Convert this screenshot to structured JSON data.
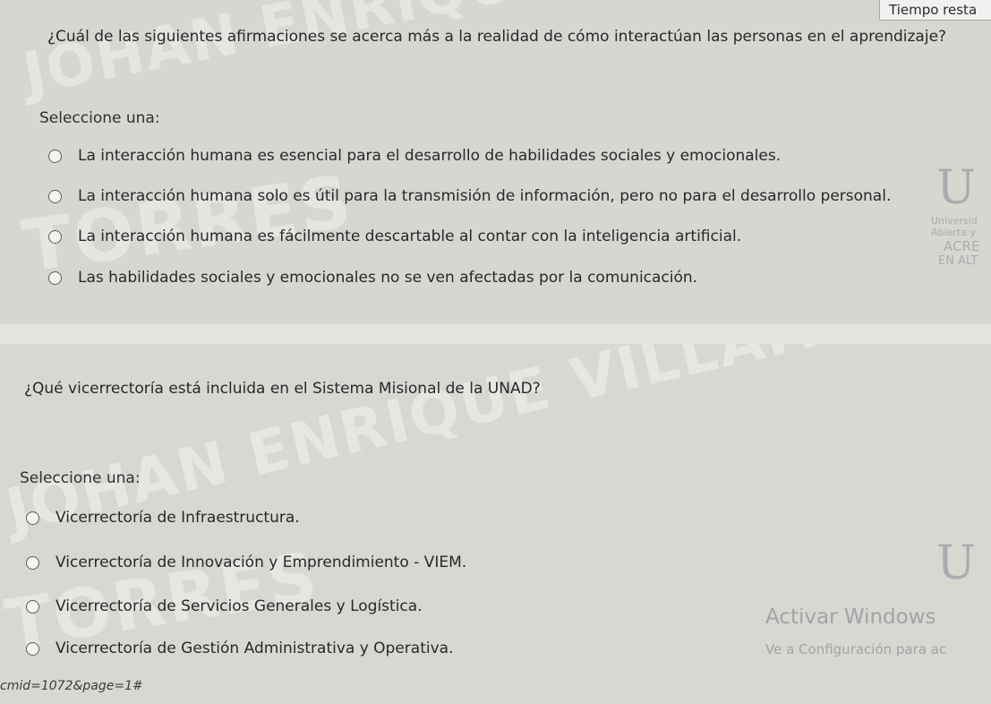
{
  "timer": {
    "label": "Tiempo resta"
  },
  "question1": {
    "text": "¿Cuál de las siguientes afirmaciones se acerca más a la realidad de cómo interactúan las personas en el aprendizaje?",
    "prompt": "Seleccione una:",
    "options": [
      "La interacción humana es esencial para el desarrollo de habilidades sociales y emocionales.",
      "La interacción humana solo es útil para la transmisión de información, pero no para el desarrollo personal.",
      "La interacción humana es fácilmente descartable al contar con la inteligencia artificial.",
      "Las habilidades sociales y emocionales no se ven afectadas por la comunicación."
    ]
  },
  "question2": {
    "text": "¿Qué vicerrectoría está incluida en el Sistema Misional de la UNAD?",
    "prompt": "Seleccione una:",
    "options": [
      "Vicerrectoría de Infraestructura.",
      "Vicerrectoría de Innovación y Emprendimiento - VIEM.",
      "Vicerrectoría de Servicios Generales y Logística.",
      "Vicerrectoría de Gestión Administrativa y Operativa."
    ]
  },
  "watermark": {
    "line1": "JOHAN ENRIQUE VILLAFAN",
    "line2": "TORRES"
  },
  "logo": {
    "letter": "U",
    "line1": "Universid",
    "line2": "Abierta y",
    "line3": "ACRE",
    "line4": "EN ALT"
  },
  "activation": {
    "title": "Activar Windows",
    "subtitle": "Ve a Configuración para ac"
  },
  "status_url": "cmid=1072&page=1#"
}
